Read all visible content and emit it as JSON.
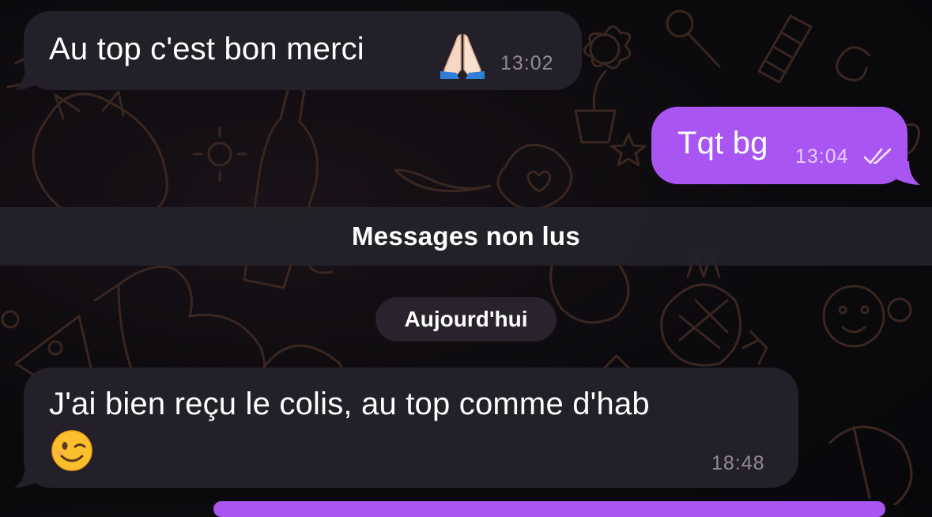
{
  "messages": [
    {
      "direction": "incoming",
      "text": "Au top c'est bon merci",
      "emoji": "folded-hands",
      "time": "13:02"
    },
    {
      "direction": "outgoing",
      "text": "Tqt bg",
      "time": "13:04",
      "status": "read"
    },
    {
      "direction": "incoming",
      "text": "J'ai bien reçu le colis, au top comme d'hab",
      "emoji": "winking-face",
      "time": "18:48"
    }
  ],
  "unread_banner": "Messages non lus",
  "date_separator": "Aujourd'hui",
  "colors": {
    "incoming_bubble": "#24202a",
    "outgoing_bubble": "#a855f2",
    "background": "#0b0a0d",
    "time_incoming": "#8f8a98"
  }
}
